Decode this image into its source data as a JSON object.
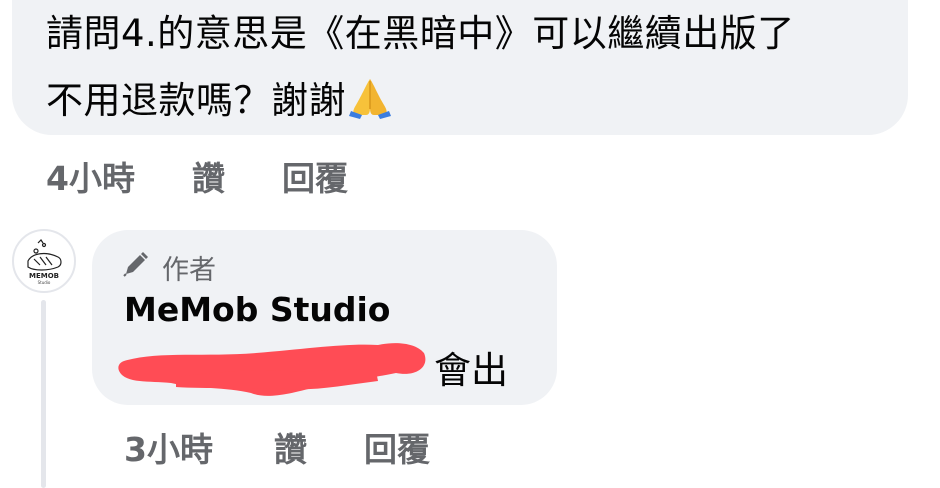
{
  "parent_comment": {
    "line1": "請問4.的意思是《在黑暗中》可以繼續出版了",
    "line2": "不用退款嗎？謝謝",
    "emoji_icon": "folded-hands-icon",
    "time": "4小時",
    "like_label": "讚",
    "reply_label": "回覆"
  },
  "reply_comment": {
    "avatar_label": "MEMOB",
    "avatar_sublabel": "Studio",
    "author_badge": "作者",
    "author_name": "MeMob Studio",
    "text_visible": "會出",
    "time": "3小時",
    "like_label": "讚",
    "reply_label": "回覆"
  },
  "colors": {
    "bubble": "#f0f2f5",
    "meta_text": "#65676b",
    "body_text": "#050505",
    "redaction": "#ff4c55",
    "thread_line": "#e4e6eb"
  }
}
